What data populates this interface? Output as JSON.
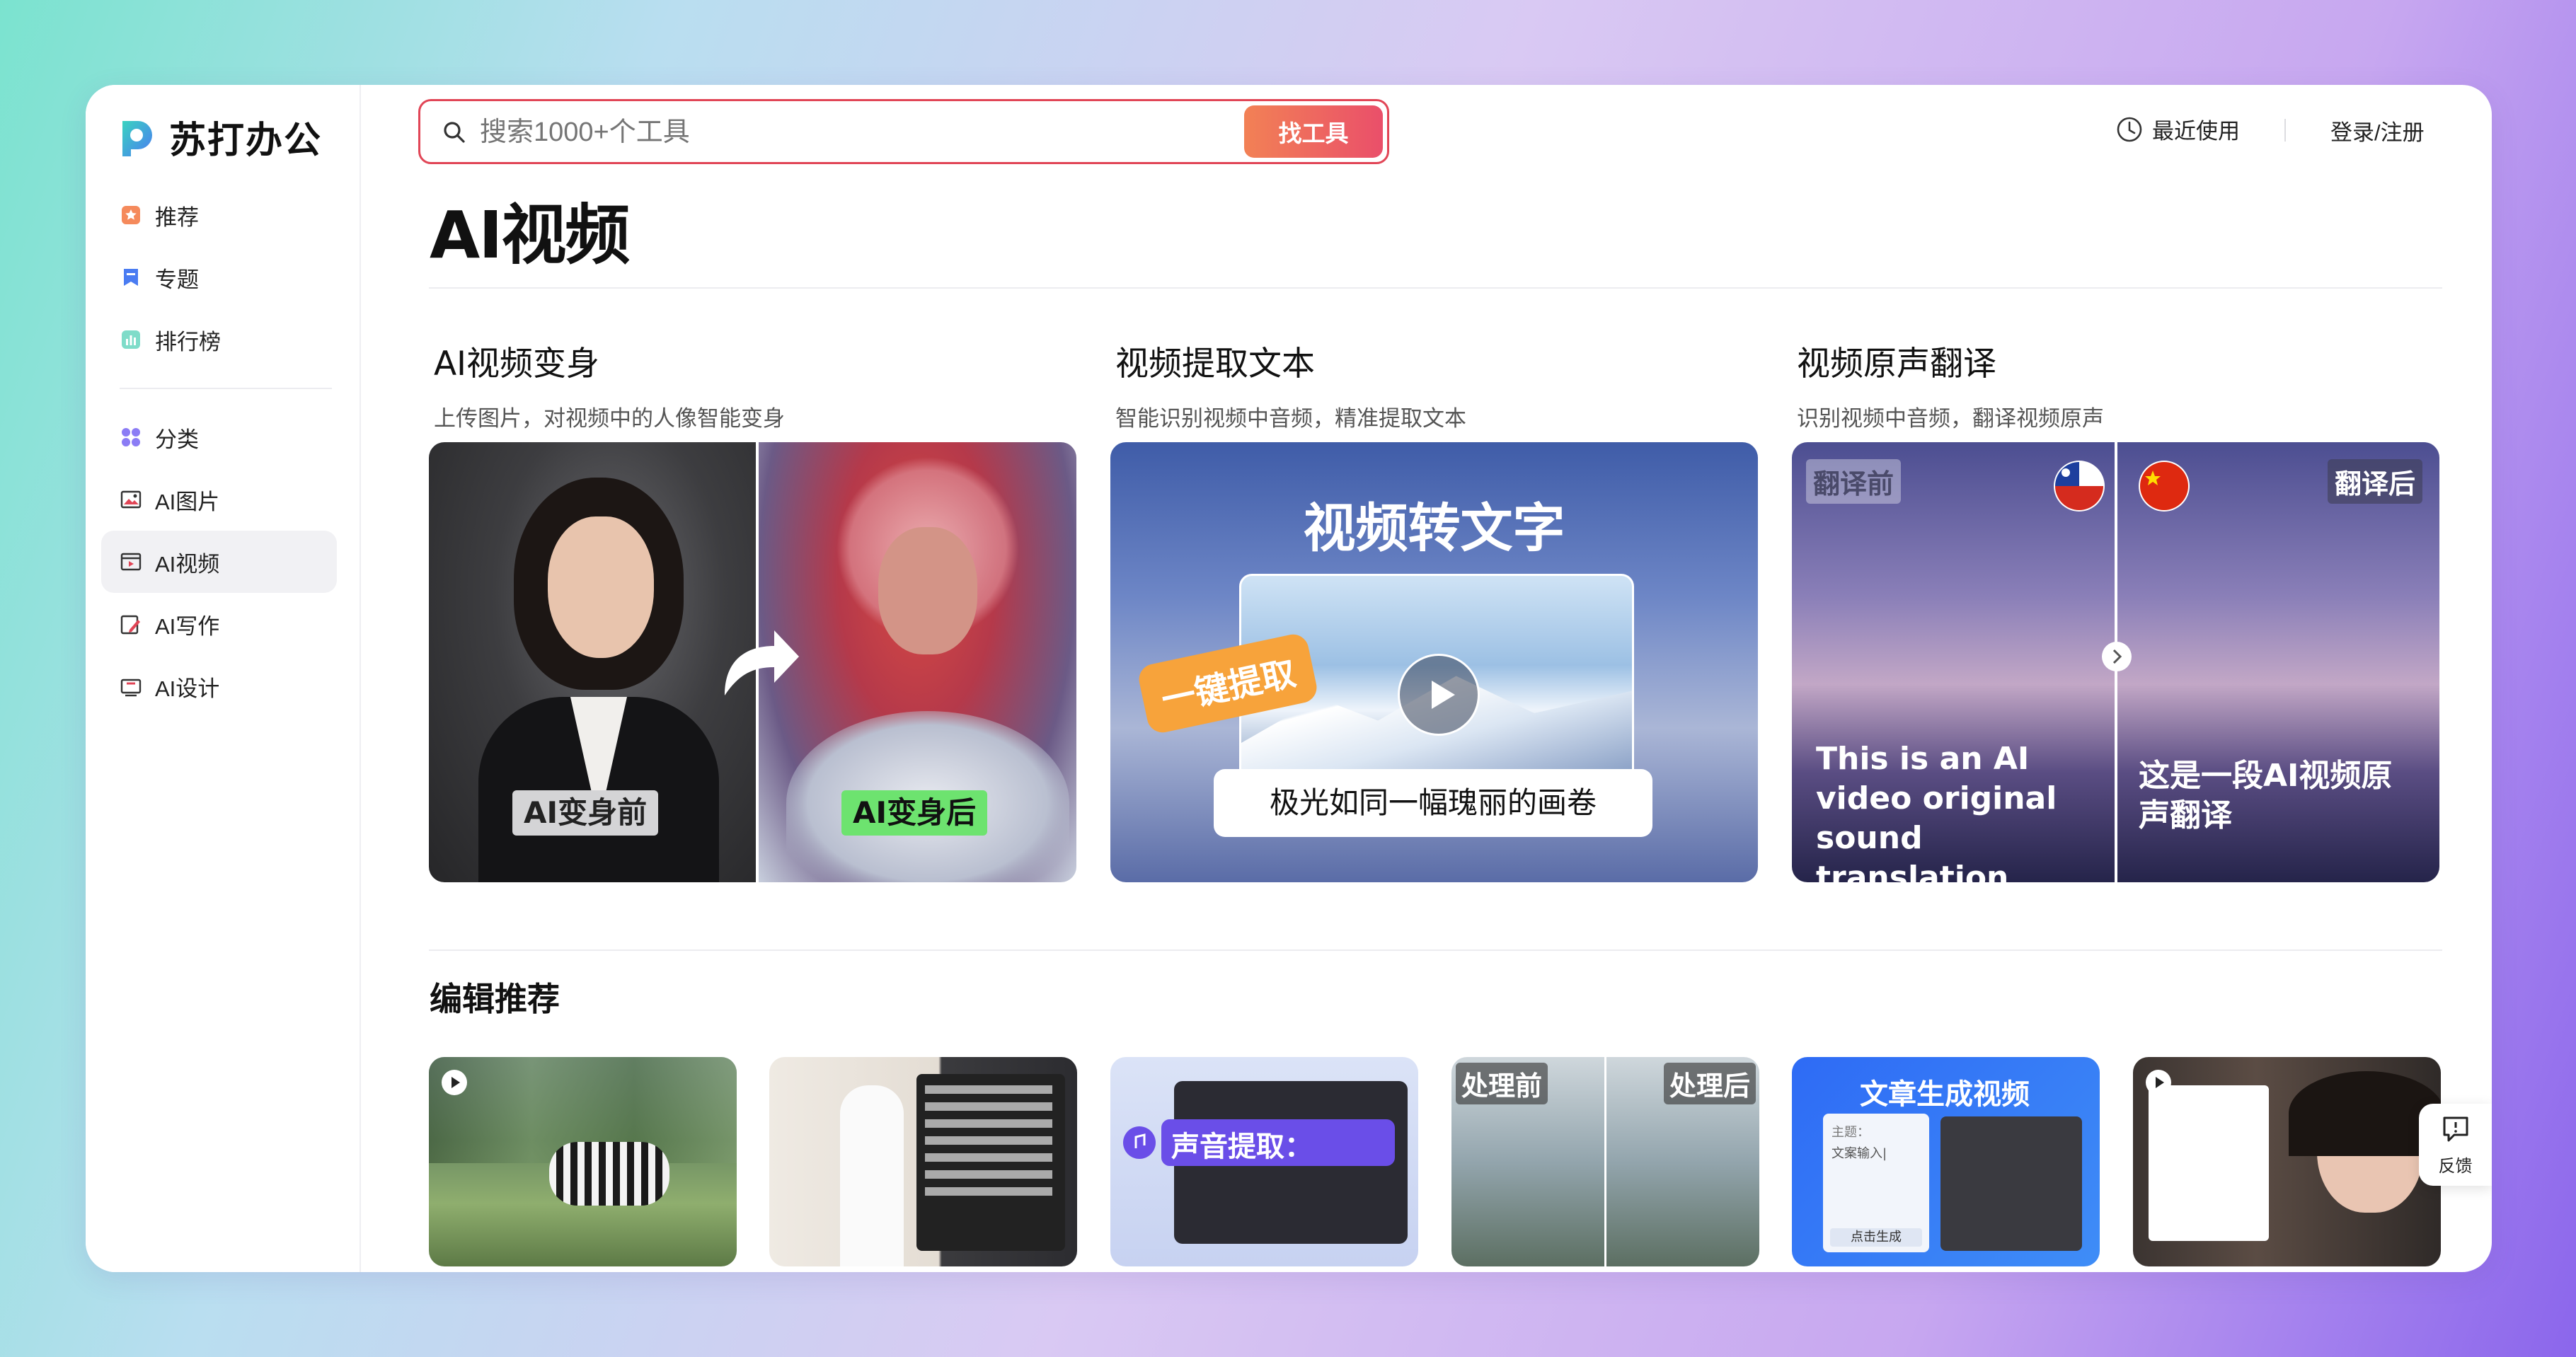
{
  "brand": {
    "name": "苏打办公"
  },
  "sidebar": {
    "top_items": [
      {
        "label": "推荐",
        "icon": "star-icon"
      },
      {
        "label": "专题",
        "icon": "bookmark-icon"
      },
      {
        "label": "排行榜",
        "icon": "bar-chart-icon"
      }
    ],
    "category_items": [
      {
        "label": "分类",
        "icon": "grid-dots-icon"
      },
      {
        "label": "AI图片",
        "icon": "image-icon"
      },
      {
        "label": "AI视频",
        "icon": "video-icon",
        "active": true
      },
      {
        "label": "AI写作",
        "icon": "pen-icon"
      },
      {
        "label": "AI设计",
        "icon": "design-icon"
      }
    ]
  },
  "header": {
    "search_placeholder": "搜索1000+个工具",
    "search_button": "找工具",
    "recent": "最近使用",
    "login": "登录/注册"
  },
  "main": {
    "title": "AI视频",
    "features": [
      {
        "title": "AI视频变身",
        "desc": "上传图片，对视频中的人像智能变身",
        "before_label": "AI变身前",
        "after_label": "AI变身后"
      },
      {
        "title": "视频提取文本",
        "desc": "智能识别视频中音频，精准提取文本",
        "headline": "视频转文字",
        "badge": "一键提取",
        "caption": "极光如同一幅瑰丽的画卷"
      },
      {
        "title": "视频原声翻译",
        "desc": "识别视频中音频，翻译视频原声",
        "before_label": "翻译前",
        "after_label": "翻译后",
        "source_text": "This is an AI video original sound translation",
        "translated_text": "这是一段AI视频原声翻译"
      }
    ],
    "editor_section_title": "编辑推荐",
    "thumbs": [
      {
        "label": ""
      },
      {
        "label": ""
      },
      {
        "label": "声音提取："
      },
      {
        "before": "处理前",
        "after": "处理后"
      },
      {
        "label": "文章生成视频",
        "subject": "主题：",
        "input": "文案输入|",
        "button": "点击生成"
      },
      {
        "label": ""
      }
    ]
  },
  "feedback": {
    "label": "反馈"
  },
  "colors": {
    "accent": "#e14556",
    "button_from": "#f28155",
    "button_to": "#ea4f6a",
    "active_bg": "#f1f1f4"
  }
}
